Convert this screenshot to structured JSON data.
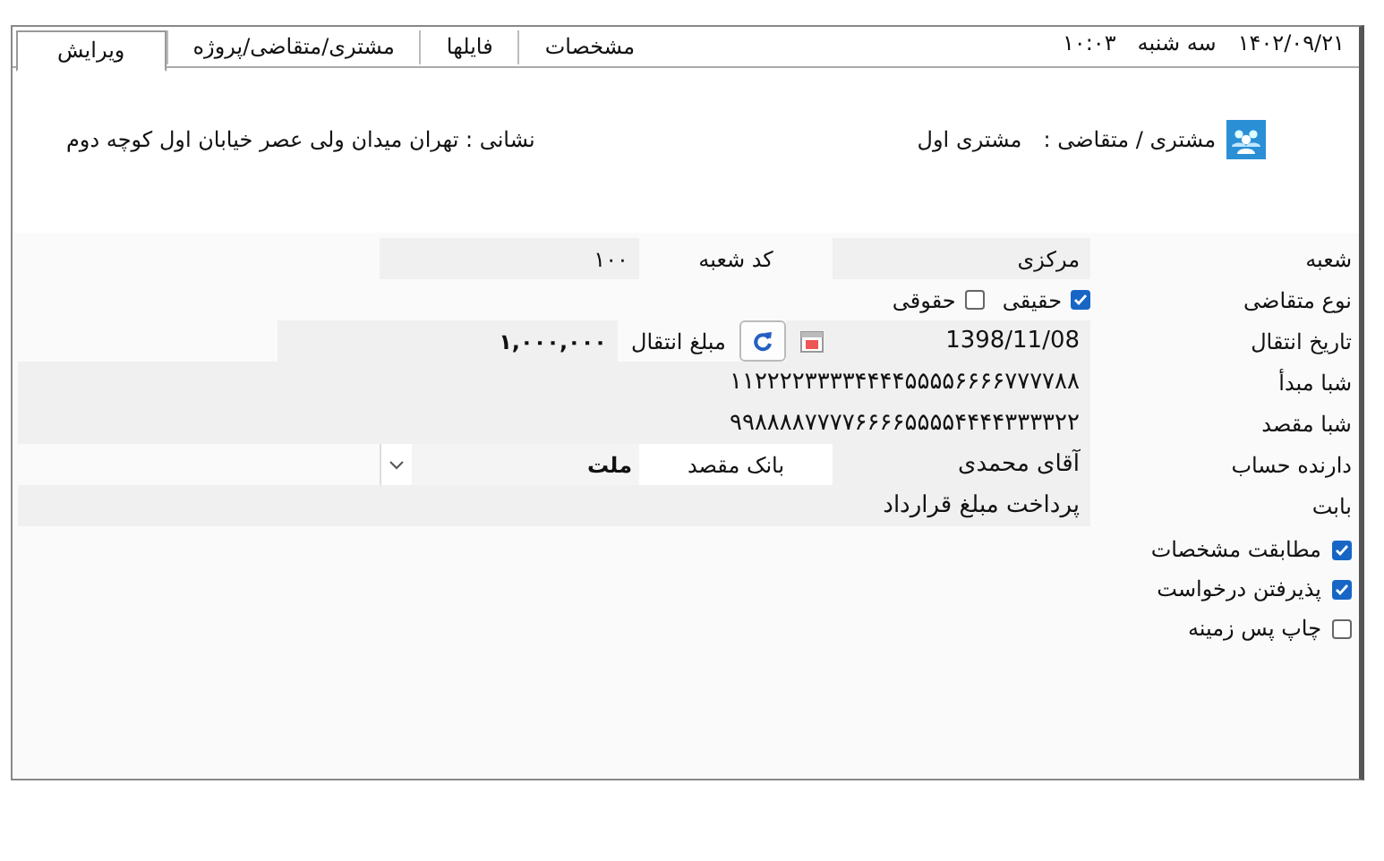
{
  "tabs": [
    {
      "label": "مشخصات",
      "selected": false
    },
    {
      "label": "فایلها",
      "selected": false
    },
    {
      "label": "مشتری/متقاضی/پروژه",
      "selected": false
    },
    {
      "label": "ویرایش",
      "selected": true
    }
  ],
  "clock": {
    "time": "۱۰:۰۳",
    "weekday": "سه شنبه",
    "date": "۱۴۰۲/۰۹/۲۱"
  },
  "header": {
    "customer_label": "مشتری / متقاضی :",
    "customer": "مشتری اول",
    "address": "نشانی : تهران میدان ولی عصر خیابان اول کوچه دوم"
  },
  "form": {
    "branch": {
      "label": "شعبه",
      "value": "مرکزی",
      "code_label": "کد شعبه",
      "code": "۱۰۰"
    },
    "applicant_type": {
      "label": "نوع متقاضی",
      "options": [
        {
          "label": "حقیقی",
          "checked": true
        },
        {
          "label": "حقوقی",
          "checked": false
        }
      ]
    },
    "transfer": {
      "label": "تاریخ انتقال",
      "date": "1398/11/08",
      "amount_label": "مبلغ انتقال",
      "amount": "۱,۰۰۰,۰۰۰"
    },
    "iban_from": {
      "label": "شبا مبدأ",
      "value": "۱۱۲۲۲۲۳۳۳۳۴۴۴۴۵۵۵۵۶۶۶۶۷۷۷۷۸۸"
    },
    "iban_to": {
      "label": "شبا مقصد",
      "value": "۹۹۸۸۸۸۷۷۷۷۶۶۶۶۵۵۵۵۴۴۴۴۳۳۳۳۲۲"
    },
    "holder": {
      "label": "دارنده حساب",
      "value": "آقای محمدی",
      "bank_label": "بانک مقصد",
      "bank": "ملت"
    },
    "purpose": {
      "label": "بابت",
      "value": "پرداخت مبلغ قرارداد"
    }
  },
  "options": [
    {
      "label": "مطابقت مشخصات",
      "checked": true
    },
    {
      "label": "پذیرفتن درخواست",
      "checked": true
    },
    {
      "label": "چاپ پس زمینه",
      "checked": false
    }
  ]
}
